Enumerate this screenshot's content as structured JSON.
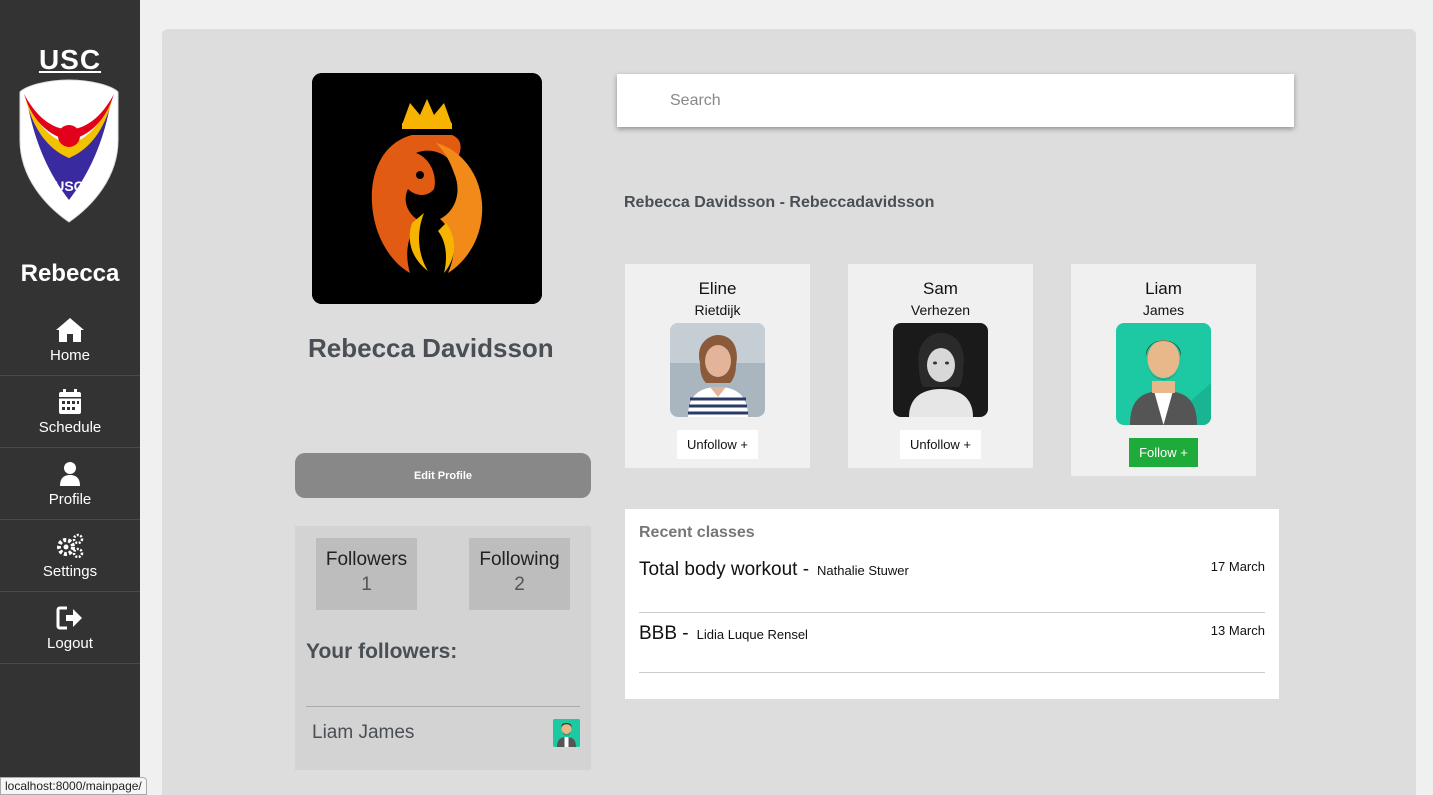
{
  "sidebar": {
    "brand": "USC",
    "logo_text": "USC",
    "user_name": "Rebecca",
    "items": [
      {
        "label": "Home",
        "icon": "home-icon"
      },
      {
        "label": "Schedule",
        "icon": "calendar-icon"
      },
      {
        "label": "Profile",
        "icon": "user-icon"
      },
      {
        "label": "Settings",
        "icon": "gears-icon"
      },
      {
        "label": "Logout",
        "icon": "logout-icon"
      }
    ]
  },
  "profile": {
    "full_name": "Rebecca Davidsson",
    "edit_label": "Edit Profile",
    "followers_label": "Followers",
    "followers_count": "1",
    "following_label": "Following",
    "following_count": "2",
    "your_followers_title": "Your followers:",
    "followers_list": [
      {
        "name": "Liam James"
      }
    ]
  },
  "search": {
    "placeholder": "Search"
  },
  "handle": "Rebecca Davidsson - Rebeccadavidsson",
  "suggestions": [
    {
      "first": "Eline",
      "last": "Rietdijk",
      "button": "Unfollow +",
      "action": "unfollow"
    },
    {
      "first": "Sam",
      "last": "Verhezen",
      "button": "Unfollow +",
      "action": "unfollow"
    },
    {
      "first": "Liam",
      "last": "James",
      "button": "Follow +",
      "action": "follow"
    }
  ],
  "recent": {
    "title": "Recent classes",
    "classes": [
      {
        "name": "Total body workout -",
        "trainer": "Nathalie Stuwer",
        "date": "17 March"
      },
      {
        "name": "BBB -",
        "trainer": "Lidia Luque Rensel",
        "date": "13 March"
      }
    ]
  },
  "status_bar": {
    "url": "localhost:8000/mainpage/"
  },
  "colors": {
    "sidebar": "#333333",
    "follow_green": "#1eab3a",
    "panel": "#dddddd"
  }
}
